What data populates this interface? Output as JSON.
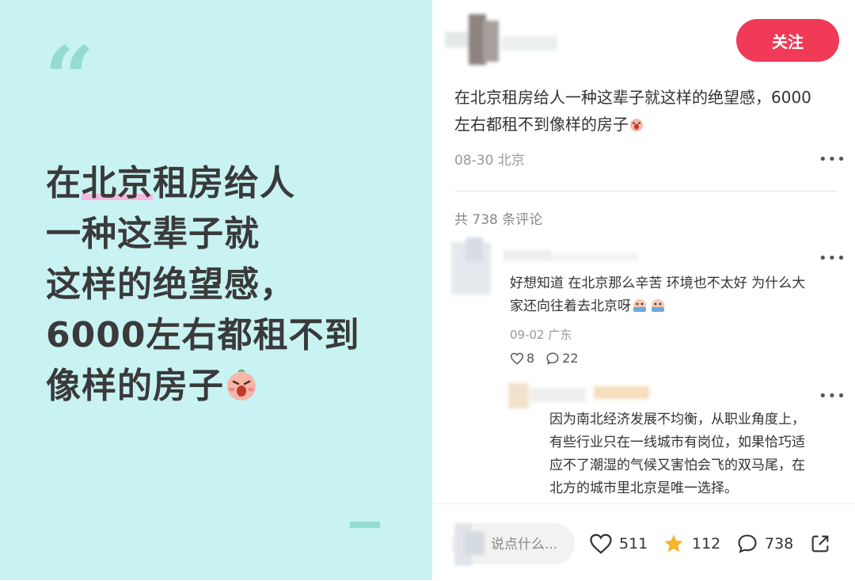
{
  "poster": {
    "quote_mark": "“",
    "lines": [
      {
        "pre": "在",
        "highlight": "北京",
        "post": "租房给人"
      },
      {
        "text": "一种这辈子就"
      },
      {
        "text": "这样的绝望感，"
      },
      {
        "text": "6000左右都租不到"
      },
      {
        "text": "像样的房子"
      }
    ]
  },
  "post": {
    "follow_label": "关注",
    "text_line1": "在北京租房给人一种这辈子就这样的绝望感，6000",
    "text_line2": "左右都租不到像样的房子",
    "meta": "08-30 北京",
    "comment_count": "共 738 条评论"
  },
  "comments": [
    {
      "text_line1": "好想知道 在北京那么辛苦 环境也不太好 为什么大",
      "text_line2": "家还向往着去北京呀",
      "meta": "09-02 广东",
      "likes": "8",
      "replies": "22"
    },
    {
      "lines": [
        "因为南北经济发展不均衡，从职业角度上，",
        "有些行业只在一线城市有岗位，如果恰巧适",
        "应不了潮湿的气候又害怕会飞的双马尾，在",
        "北方的城市里北京是唯一选择。"
      ]
    }
  ],
  "bottom_bar": {
    "input_placeholder": "说点什么...",
    "likes": "511",
    "stars": "112",
    "comments": "738"
  },
  "icons": {
    "like": "heart-icon",
    "star": "star-icon",
    "comment": "comment-bubble-icon",
    "share": "share-icon",
    "more": "more-dots-icon"
  },
  "colors": {
    "poster_bg": "#c8f3f2",
    "accent": "#93dccf",
    "highlight": "#f5b8de",
    "follow_button": "#f03a57",
    "star": "#f7b52b"
  }
}
